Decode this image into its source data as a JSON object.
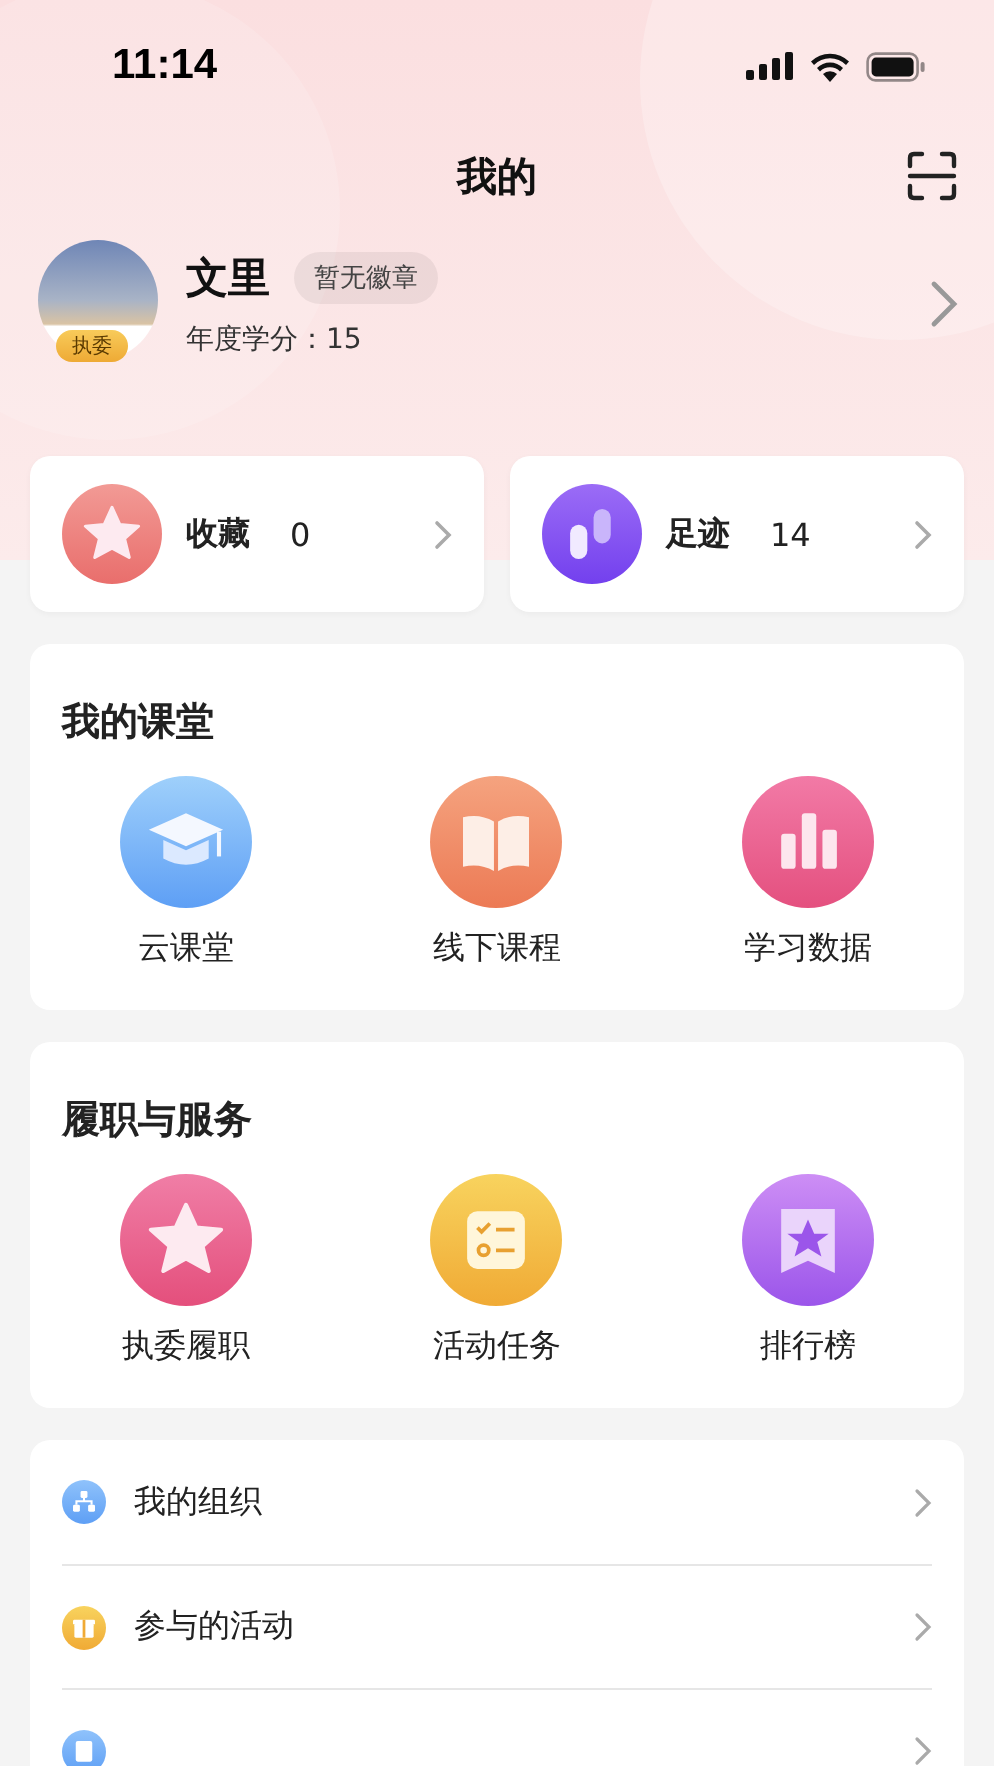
{
  "status_bar": {
    "time": "11:14"
  },
  "header": {
    "title": "我的"
  },
  "profile": {
    "name": "文里",
    "badge": "暂无徽章",
    "credits": "年度学分：15",
    "role_tag": "执委"
  },
  "quick_links": [
    {
      "kind": "favorites",
      "label": "收藏",
      "count": "0"
    },
    {
      "kind": "footprints",
      "label": "足迹",
      "count": "14"
    }
  ],
  "sections": [
    {
      "title": "我的课堂",
      "items": [
        {
          "kind": "cap",
          "label": "云课堂"
        },
        {
          "kind": "book",
          "label": "线下课程"
        },
        {
          "kind": "chart",
          "label": "学习数据"
        }
      ]
    },
    {
      "title": "履职与服务",
      "items": [
        {
          "kind": "star",
          "label": "执委履职"
        },
        {
          "kind": "tasks",
          "label": "活动任务"
        },
        {
          "kind": "rank",
          "label": "排行榜"
        }
      ]
    }
  ],
  "menu": [
    {
      "kind": "org",
      "label": "我的组织"
    },
    {
      "kind": "gift",
      "label": "参与的活动"
    },
    {
      "kind": "exam"
    }
  ]
}
